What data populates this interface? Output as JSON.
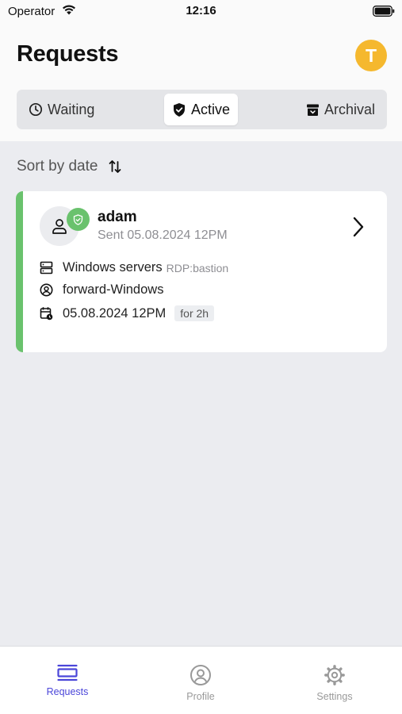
{
  "status_bar": {
    "carrier": "Operator",
    "time": "12:16"
  },
  "header": {
    "title": "Requests",
    "avatar_initial": "T",
    "avatar_color": "#F5B82E"
  },
  "segments": [
    {
      "label": "Waiting",
      "icon": "clock-icon",
      "selected": false
    },
    {
      "label": "Active",
      "icon": "shield-check-icon",
      "selected": true
    },
    {
      "label": "Archival",
      "icon": "archive-icon",
      "selected": false
    }
  ],
  "sort": {
    "label": "Sort by date",
    "icon": "sort-arrows-icon"
  },
  "requests": [
    {
      "user": "adam",
      "sent": "Sent 05.08.2024 12PM",
      "status_color": "#6AC26D",
      "resource": "Windows servers",
      "protocol": "RDP:bastion",
      "account": "forward-Windows",
      "date": "05.08.2024 12PM",
      "duration": "for 2h"
    }
  ],
  "tabbar": [
    {
      "label": "Requests",
      "icon": "requests-icon",
      "active": true
    },
    {
      "label": "Profile",
      "icon": "user-circle-icon",
      "active": false
    },
    {
      "label": "Settings",
      "icon": "gear-icon",
      "active": false
    }
  ],
  "colors": {
    "accent": "#4B46D9",
    "active_green": "#6AC26D",
    "background": "#EBECF0"
  }
}
